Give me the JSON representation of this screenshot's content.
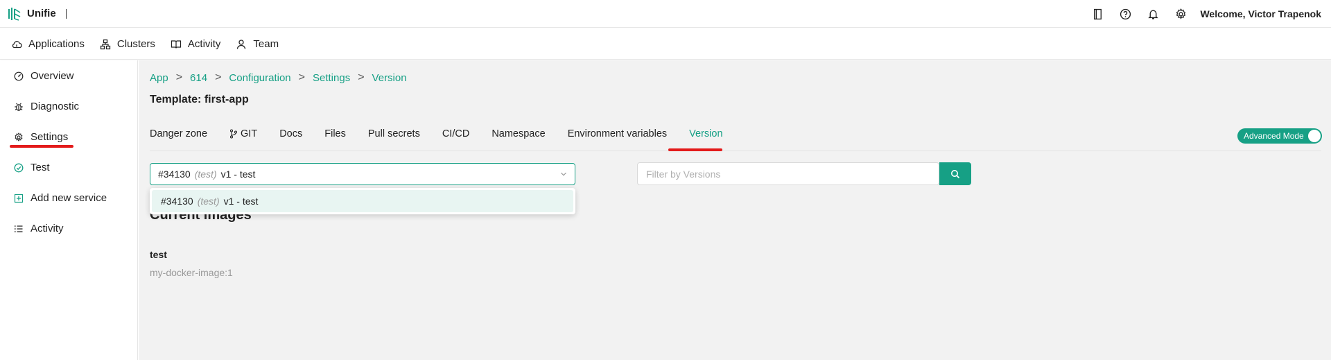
{
  "app": {
    "name": "Unifie"
  },
  "topbar": {
    "icons": [
      "book-icon",
      "help-icon",
      "bell-icon",
      "gear-icon"
    ],
    "welcome": "Welcome, Victor Trapenok"
  },
  "nav": {
    "items": [
      {
        "label": "Applications",
        "icon": "cloud-icon"
      },
      {
        "label": "Clusters",
        "icon": "cluster-icon"
      },
      {
        "label": "Activity",
        "icon": "book-open-icon"
      },
      {
        "label": "Team",
        "icon": "user-icon"
      }
    ]
  },
  "sidebar": {
    "items": [
      {
        "label": "Overview",
        "icon": "dashboard-icon"
      },
      {
        "label": "Diagnostic",
        "icon": "bug-icon"
      },
      {
        "label": "Settings",
        "icon": "gear-icon",
        "active": true
      },
      {
        "label": "Test",
        "icon": "check-circle-icon"
      },
      {
        "label": "Add new service",
        "icon": "add-box-icon"
      },
      {
        "label": "Activity",
        "icon": "list-icon"
      }
    ]
  },
  "breadcrumb": [
    "App",
    "614",
    "Configuration",
    "Settings",
    "Version"
  ],
  "page": {
    "title": "Template: first-app"
  },
  "tabs": {
    "items": [
      "Danger zone",
      "GIT",
      "Docs",
      "Files",
      "Pull secrets",
      "CI/CD",
      "Namespace",
      "Environment variables",
      "Version"
    ],
    "active": "Version"
  },
  "advanced_mode": {
    "label": "Advanced Mode",
    "on": true
  },
  "version_select": {
    "selected": {
      "id": "#34130",
      "env": "(test)",
      "name": "v1 - test"
    },
    "options": [
      {
        "id": "#34130",
        "env": "(test)",
        "name": "v1 - test"
      }
    ]
  },
  "filter": {
    "placeholder": "Filter by Versions",
    "value": ""
  },
  "images": {
    "title": "Current images",
    "items": [
      {
        "name": "test",
        "image": "my-docker-image:1"
      }
    ]
  },
  "colors": {
    "accent": "#16a085",
    "highlight": "#e31b1b",
    "background": "#f2f2f2"
  }
}
